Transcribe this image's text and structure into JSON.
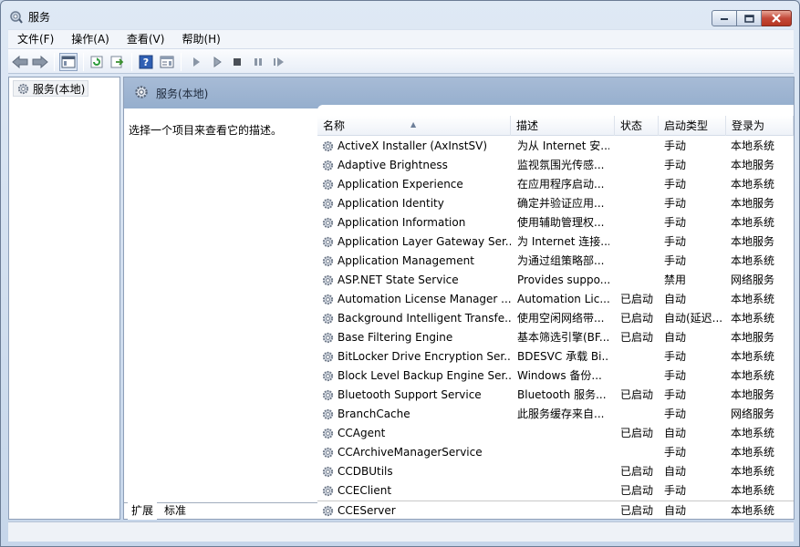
{
  "window": {
    "title": "服务"
  },
  "menu": [
    "文件(F)",
    "操作(A)",
    "查看(V)",
    "帮助(H)"
  ],
  "tree": {
    "root_label": "服务(本地)"
  },
  "panel": {
    "title": "服务(本地)",
    "description_prompt": "选择一个项目来查看它的描述。"
  },
  "columns": {
    "name": "名称",
    "desc": "描述",
    "status": "状态",
    "startup": "启动类型",
    "logon": "登录为"
  },
  "services": [
    {
      "name": "ActiveX Installer (AxInstSV)",
      "desc": "为从 Internet 安...",
      "status": "",
      "startup": "手动",
      "logon": "本地系统"
    },
    {
      "name": "Adaptive Brightness",
      "desc": "监视氛围光传感...",
      "status": "",
      "startup": "手动",
      "logon": "本地服务"
    },
    {
      "name": "Application Experience",
      "desc": "在应用程序启动...",
      "status": "",
      "startup": "手动",
      "logon": "本地系统"
    },
    {
      "name": "Application Identity",
      "desc": "确定并验证应用...",
      "status": "",
      "startup": "手动",
      "logon": "本地服务"
    },
    {
      "name": "Application Information",
      "desc": "使用辅助管理权...",
      "status": "",
      "startup": "手动",
      "logon": "本地系统"
    },
    {
      "name": "Application Layer Gateway Ser...",
      "desc": "为 Internet 连接...",
      "status": "",
      "startup": "手动",
      "logon": "本地服务"
    },
    {
      "name": "Application Management",
      "desc": "为通过组策略部...",
      "status": "",
      "startup": "手动",
      "logon": "本地系统"
    },
    {
      "name": "ASP.NET State Service",
      "desc": "Provides suppo...",
      "status": "",
      "startup": "禁用",
      "logon": "网络服务"
    },
    {
      "name": "Automation License Manager ...",
      "desc": "Automation Lic...",
      "status": "已启动",
      "startup": "自动",
      "logon": "本地系统"
    },
    {
      "name": "Background Intelligent Transfe...",
      "desc": "使用空闲网络带...",
      "status": "已启动",
      "startup": "自动(延迟...",
      "logon": "本地系统"
    },
    {
      "name": "Base Filtering Engine",
      "desc": "基本筛选引擎(BF...",
      "status": "已启动",
      "startup": "自动",
      "logon": "本地服务"
    },
    {
      "name": "BitLocker Drive Encryption Ser...",
      "desc": "BDESVC 承载 Bi...",
      "status": "",
      "startup": "手动",
      "logon": "本地系统"
    },
    {
      "name": "Block Level Backup Engine Ser...",
      "desc": "Windows 备份...",
      "status": "",
      "startup": "手动",
      "logon": "本地系统"
    },
    {
      "name": "Bluetooth Support Service",
      "desc": "Bluetooth 服务...",
      "status": "已启动",
      "startup": "手动",
      "logon": "本地服务"
    },
    {
      "name": "BranchCache",
      "desc": "此服务缓存来自...",
      "status": "",
      "startup": "手动",
      "logon": "网络服务"
    },
    {
      "name": "CCAgent",
      "desc": "",
      "status": "已启动",
      "startup": "自动",
      "logon": "本地系统"
    },
    {
      "name": "CCArchiveManagerService",
      "desc": "",
      "status": "",
      "startup": "手动",
      "logon": "本地系统"
    },
    {
      "name": "CCDBUtils",
      "desc": "",
      "status": "已启动",
      "startup": "自动",
      "logon": "本地系统"
    },
    {
      "name": "CCEClient",
      "desc": "",
      "status": "已启动",
      "startup": "手动",
      "logon": "本地系统"
    },
    {
      "name": "CCEServer",
      "desc": "",
      "status": "已启动",
      "startup": "自动",
      "logon": "本地系统"
    }
  ],
  "tabs": {
    "extended": "扩展",
    "standard": "标准"
  }
}
